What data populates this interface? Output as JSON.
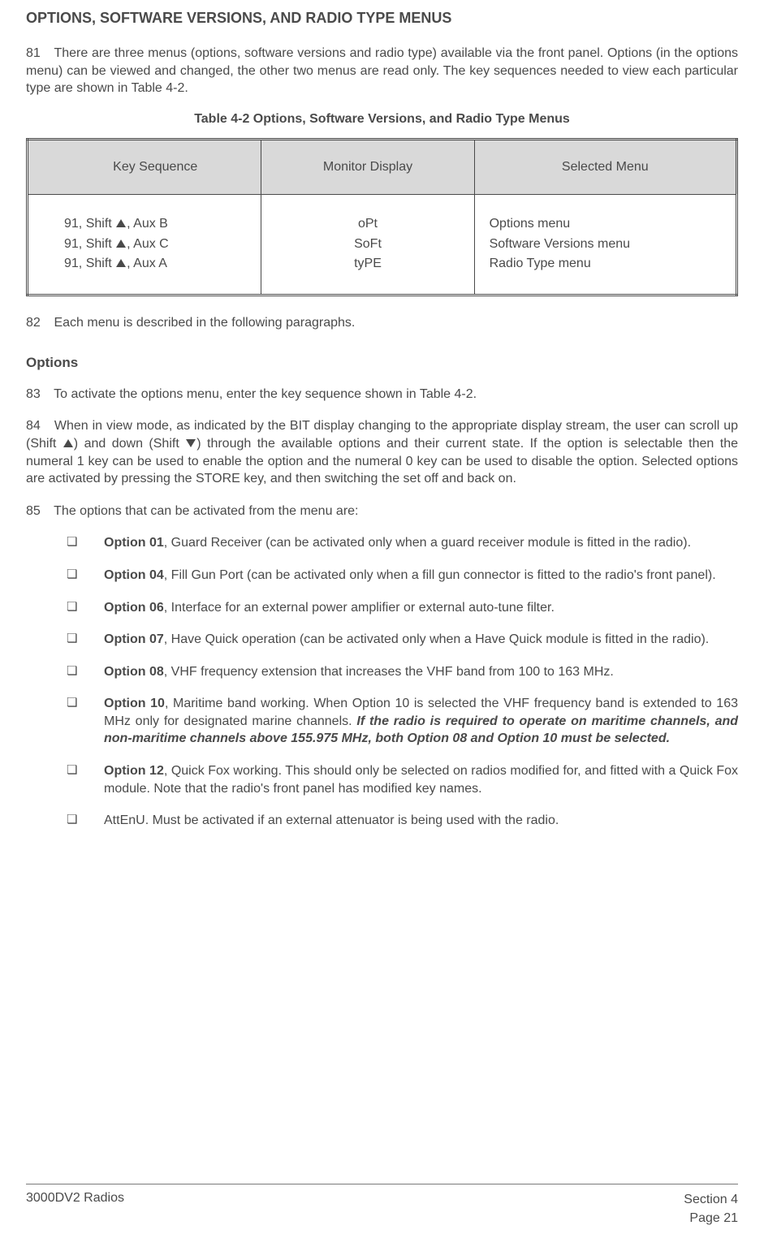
{
  "heading": "OPTIONS, SOFTWARE VERSIONS, AND RADIO TYPE MENUS",
  "para81_pre": "81",
  "para81": "There are three menus (options, software versions and radio type) available via the front panel. Options (in the options menu) can be viewed and changed, the other two menus are read only. The key sequences needed to view each particular type are shown in Table 4-2.",
  "table_caption": "Table 4-2  Options, Software Versions, and Radio Type Menus",
  "th1": "Key Sequence",
  "th2": "Monitor Display",
  "th3": "Selected Menu",
  "ks1a": "91, Shift ",
  "ks1b": ", Aux B",
  "ks2a": "91, Shift ",
  "ks2b": ", Aux C",
  "ks3a": "91, Shift ",
  "ks3b": ", Aux A",
  "md1": "oPt",
  "md2": "SoFt",
  "md3": "tyPE",
  "sm1": "Options menu",
  "sm2": "Software Versions menu",
  "sm3": "Radio Type menu",
  "para82_pre": "82",
  "para82": "Each menu is described in the following paragraphs.",
  "sub_options": "Options",
  "para83_pre": "83",
  "para83": "To activate the options menu, enter the key sequence shown in Table 4-2.",
  "para84_pre": "84",
  "para84a": " When in view mode, as indicated by the BIT display changing to the appropriate display stream, the user can scroll up (Shift ",
  "para84b": ") and down (Shift ",
  "para84c": ") through the available options and their current state.  If the option is selectable then the numeral 1 key can be used to enable the option and the numeral 0 key can be used to disable the option.  Selected options are activated by pressing the STORE key, and then switching the set off and back on.",
  "para85_pre": "85",
  "para85": "The options that can be activated from the menu are:",
  "opt01_b": "Option 01",
  "opt01_t": ", Guard Receiver (can be activated only when a guard receiver module is fitted in the radio).",
  "opt04_b": "Option 04",
  "opt04_t": ", Fill Gun Port (can be activated only when a fill gun connector is fitted to the radio's front panel).",
  "opt06_b": "Option 06",
  "opt06_t": ", Interface for an external power amplifier or external auto-tune filter.",
  "opt07_b": "Option 07",
  "opt07_t": ", Have Quick operation (can be activated only when a Have Quick module is fitted in the radio).",
  "opt08_b": "Option 08",
  "opt08_t": ", VHF frequency extension that increases the VHF band from 100 to 163 MHz.",
  "opt10_b": "Option 10",
  "opt10_t1": ", Maritime band working. When Option 10 is selected the VHF frequency band is extended to 163 MHz only for designated marine channels. ",
  "opt10_bi": "If the radio is required to operate on maritime channels, and non-maritime channels above 155.975 MHz, both Option 08 and Option 10 must be selected.",
  "opt12_b": "Option 12",
  "opt12_t": ", Quick Fox working. This should only be selected on radios modified for, and fitted with a Quick Fox module. Note that the radio's front panel has modified key names.",
  "opt_att": "AttEnU. Must be activated if an external attenuator is being used with the radio.",
  "footer_left": "3000DV2 Radios",
  "footer_right1": "Section 4",
  "footer_right2": "Page 21"
}
